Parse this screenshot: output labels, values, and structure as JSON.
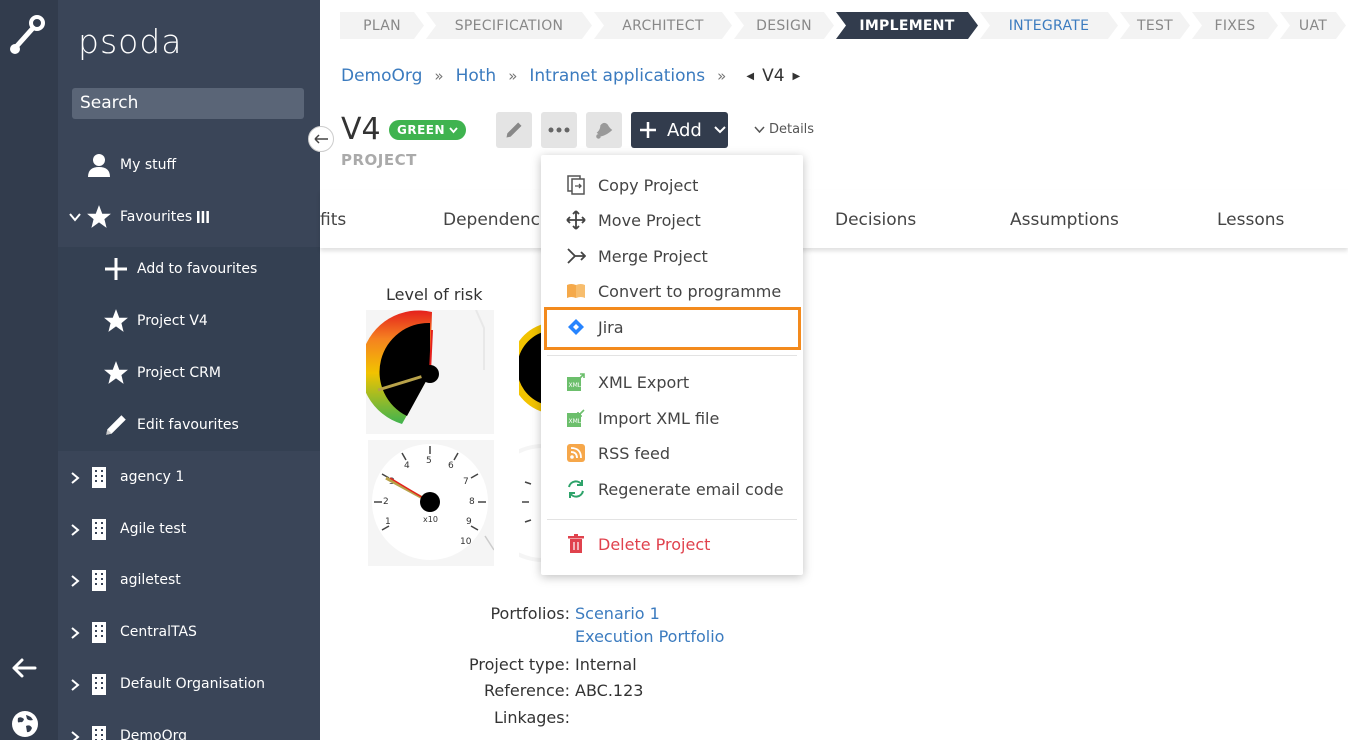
{
  "app": {
    "brand": "psoda"
  },
  "sidebar": {
    "search_placeholder": "Search",
    "my_stuff": "My stuff",
    "favourites": "Favourites",
    "fav_items": [
      "Add to favourites",
      "Project V4",
      "Project CRM",
      "Edit favourites"
    ],
    "orgs": [
      "agency 1",
      "Agile test",
      "agiletest",
      "CentralTAS",
      "Default Organisation",
      "DemoOrg"
    ]
  },
  "stages": [
    {
      "label": "PLAN",
      "state": "done"
    },
    {
      "label": "SPECIFICATION",
      "state": "done"
    },
    {
      "label": "ARCHITECT",
      "state": "done"
    },
    {
      "label": "DESIGN",
      "state": "done"
    },
    {
      "label": "IMPLEMENT",
      "state": "active"
    },
    {
      "label": "INTEGRATE",
      "state": "next"
    },
    {
      "label": "TEST",
      "state": "todo"
    },
    {
      "label": "FIXES",
      "state": "todo"
    },
    {
      "label": "UAT",
      "state": "todo"
    }
  ],
  "breadcrumb": {
    "items": [
      "DemoOrg",
      "Hoth",
      "Intranet applications"
    ],
    "separator": "»",
    "current": "V4"
  },
  "project": {
    "title": "V4",
    "status": "GREEN",
    "type_label": "PROJECT"
  },
  "toolbar": {
    "add_label": "Add",
    "details_label": "Details"
  },
  "tabs": [
    "fits",
    "Dependencies",
    "Decisions",
    "Assumptions",
    "Lessons"
  ],
  "widgets": {
    "risk_label": "Level of risk",
    "gauge_multiplier": "x10"
  },
  "info": {
    "portfolios_key": "Portfolios:",
    "portfolios": [
      "Scenario 1",
      "Execution Portfolio"
    ],
    "type_key": "Project type:",
    "type_val": "Internal",
    "ref_key": "Reference:",
    "ref_val": "ABC.123",
    "linkages_key": "Linkages:"
  },
  "menu": {
    "items": [
      {
        "label": "Copy Project",
        "icon": "copy-icon"
      },
      {
        "label": "Move Project",
        "icon": "move-icon"
      },
      {
        "label": "Merge Project",
        "icon": "merge-icon"
      },
      {
        "label": "Convert to programme",
        "icon": "book-icon"
      },
      {
        "label": "Jira",
        "icon": "jira-icon"
      },
      {
        "label": "XML Export",
        "icon": "xml-export-icon"
      },
      {
        "label": "Import XML file",
        "icon": "xml-import-icon"
      },
      {
        "label": "RSS feed",
        "icon": "rss-icon"
      },
      {
        "label": "Regenerate email code",
        "icon": "refresh-icon"
      },
      {
        "label": "Delete Project",
        "icon": "trash-icon"
      }
    ]
  },
  "colors": {
    "rail": "#323c4d",
    "sidebar": "#3a4558",
    "accent": "#3b7bbf",
    "green": "#3fb34f",
    "highlight": "#f38a1d",
    "danger": "#e0424d"
  }
}
